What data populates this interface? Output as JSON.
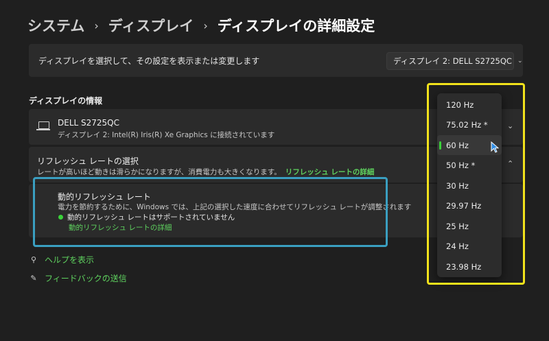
{
  "breadcrumb": {
    "items": [
      "システム",
      "ディスプレイ",
      "ディスプレイの詳細設定"
    ],
    "separator": "›"
  },
  "display_select": {
    "prompt": "ディスプレイを選択して、その設定を表示または変更します",
    "selected": "ディスプレイ 2: DELL S2725QC"
  },
  "info_section": {
    "title": "ディスプレイの情報",
    "monitor_name": "DELL S2725QC",
    "monitor_subtitle": "ディスプレイ 2: Intel(R) Iris(R) Xe Graphics に接続されています"
  },
  "refresh": {
    "title": "リフレッシュ レートの選択",
    "description": "レートが高いほど動きは滑らかになりますが、消費電力も大きくなります。",
    "link": "リフレッシュ レートの詳細"
  },
  "dynamic_refresh": {
    "title": "動的リフレッシュ レート",
    "description": "電力を節約するために、Windows では、上記の選択した速度に合わせてリフレッシュ レートが調整されます",
    "status": "動的リフレッシュ レートはサポートされていません",
    "link": "動的リフレッシュ レートの詳細"
  },
  "footer_links": {
    "help": "ヘルプを表示",
    "feedback": "フィードバックの送信"
  },
  "refresh_dropdown": {
    "options": [
      "120 Hz",
      "75.02 Hz *",
      "60 Hz",
      "50 Hz *",
      "30 Hz",
      "29.97 Hz",
      "25 Hz",
      "24 Hz",
      "23.98 Hz"
    ],
    "selected_index": 2
  },
  "colors": {
    "accent_green": "#5fd35f",
    "highlight_yellow": "#f2e21b",
    "highlight_cyan": "#3a9fc1"
  }
}
